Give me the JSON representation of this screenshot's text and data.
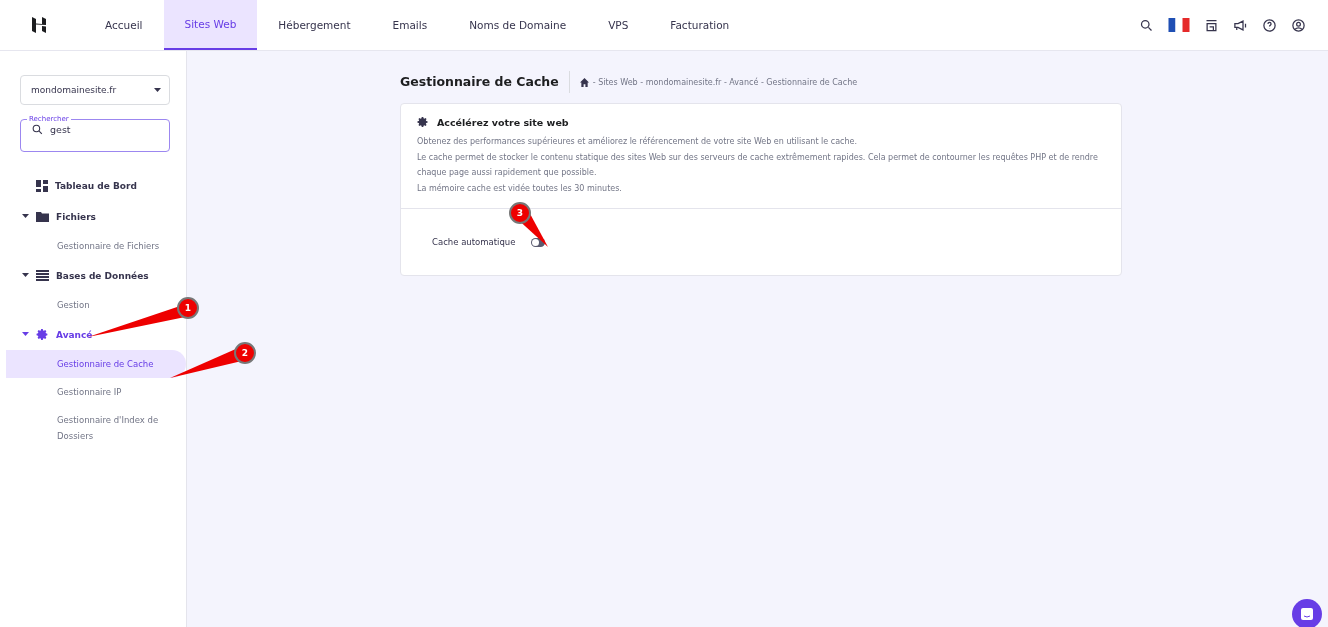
{
  "nav": {
    "tabs": [
      {
        "label": "Accueil",
        "selected": false
      },
      {
        "label": "Sites Web",
        "selected": true
      },
      {
        "label": "Hébergement",
        "selected": false
      },
      {
        "label": "Emails",
        "selected": false
      },
      {
        "label": "Noms de Domaine",
        "selected": false
      },
      {
        "label": "VPS",
        "selected": false
      },
      {
        "label": "Facturation",
        "selected": false
      }
    ]
  },
  "sidebar": {
    "domain_select": {
      "value": "mondomainesite.fr"
    },
    "search": {
      "label": "Rechercher",
      "value": "gest"
    },
    "items": [
      {
        "label": "Tableau de Bord",
        "kind": "dashboard",
        "selected": false
      },
      {
        "label": "Fichiers",
        "kind": "folder",
        "expanded": true,
        "selected": false,
        "children": [
          {
            "label": "Gestionnaire de Fichiers",
            "selected": false
          }
        ]
      },
      {
        "label": "Bases de Données",
        "kind": "list",
        "expanded": true,
        "selected": false,
        "children": [
          {
            "label": "Gestion",
            "selected": false
          }
        ]
      },
      {
        "label": "Avancé",
        "kind": "gear",
        "expanded": true,
        "selected": true,
        "children": [
          {
            "label": "Gestionnaire de Cache",
            "selected": true
          },
          {
            "label": "Gestionnaire IP",
            "selected": false
          },
          {
            "label": "Gestionnaire d'Index de Dossiers",
            "selected": false
          }
        ]
      }
    ]
  },
  "page": {
    "title": "Gestionnaire de Cache",
    "breadcrumb": "- Sites Web - mondomainesite.fr - Avancé - Gestionnaire de Cache"
  },
  "card": {
    "title": "Accélérez votre site web",
    "paragraphs": [
      "Obtenez des performances supérieures et améliorez le référencement de votre site Web en utilisant le cache.",
      "Le cache permet de stocker le contenu statique des sites Web sur des serveurs de cache extrêmement rapides. Cela permet de contourner les requêtes PHP et de rendre chaque page aussi rapidement que possible.",
      "La mémoire cache est vidée toutes les 30 minutes."
    ],
    "setting": {
      "label": "Cache automatique",
      "on": false
    }
  },
  "annotations": [
    {
      "label": "1"
    },
    {
      "label": "2"
    },
    {
      "label": "3"
    }
  ]
}
